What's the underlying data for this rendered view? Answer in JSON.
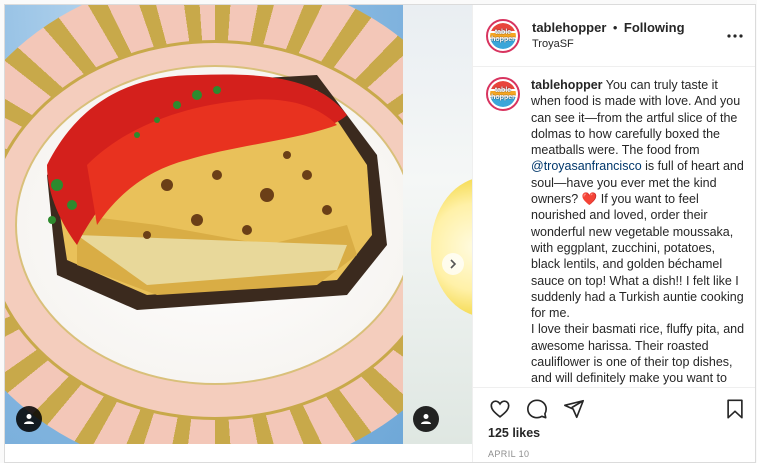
{
  "post": {
    "username": "tablehopper",
    "follow_dot": "•",
    "follow_label": "Following",
    "location": "TroyaSF",
    "avatar_text_line1": "table",
    "avatar_text_line2": "hopper",
    "more_icon": "more-horizontal-icon"
  },
  "caption": {
    "username": "tablehopper",
    "part1": " You can truly taste it when food is made with love. And you can see it—from the artful slice of the dolmas to how carefully boxed the meatballs were. The food from ",
    "mention": "@troyasanfrancisco",
    "part2": " is full of heart and soul—have you ever met the kind owners? ",
    "heart": "❤️",
    "part3": " If you want to feel nourished and loved, order their wonderful new vegetable moussaka, with eggplant, zucchini, potatoes, black lentils, and golden béchamel sauce on top! What a dish!! I felt like I suddenly had a Turkish auntie cooking for me.",
    "part4": "I love their basmati rice, fluffy pita, and awesome harissa. Their roasted cauliflower is one of their top dishes, and will definitely make you want to eat your vegetables!"
  },
  "actions": {
    "like_icon": "heart-icon",
    "comment_icon": "comment-icon",
    "share_icon": "send-icon",
    "save_icon": "bookmark-icon"
  },
  "likes": "125 likes",
  "date": "APRIL 10",
  "colors": {
    "accent_ring": "#d8345f",
    "mention": "#00376b",
    "muted": "#8e8e8e"
  }
}
